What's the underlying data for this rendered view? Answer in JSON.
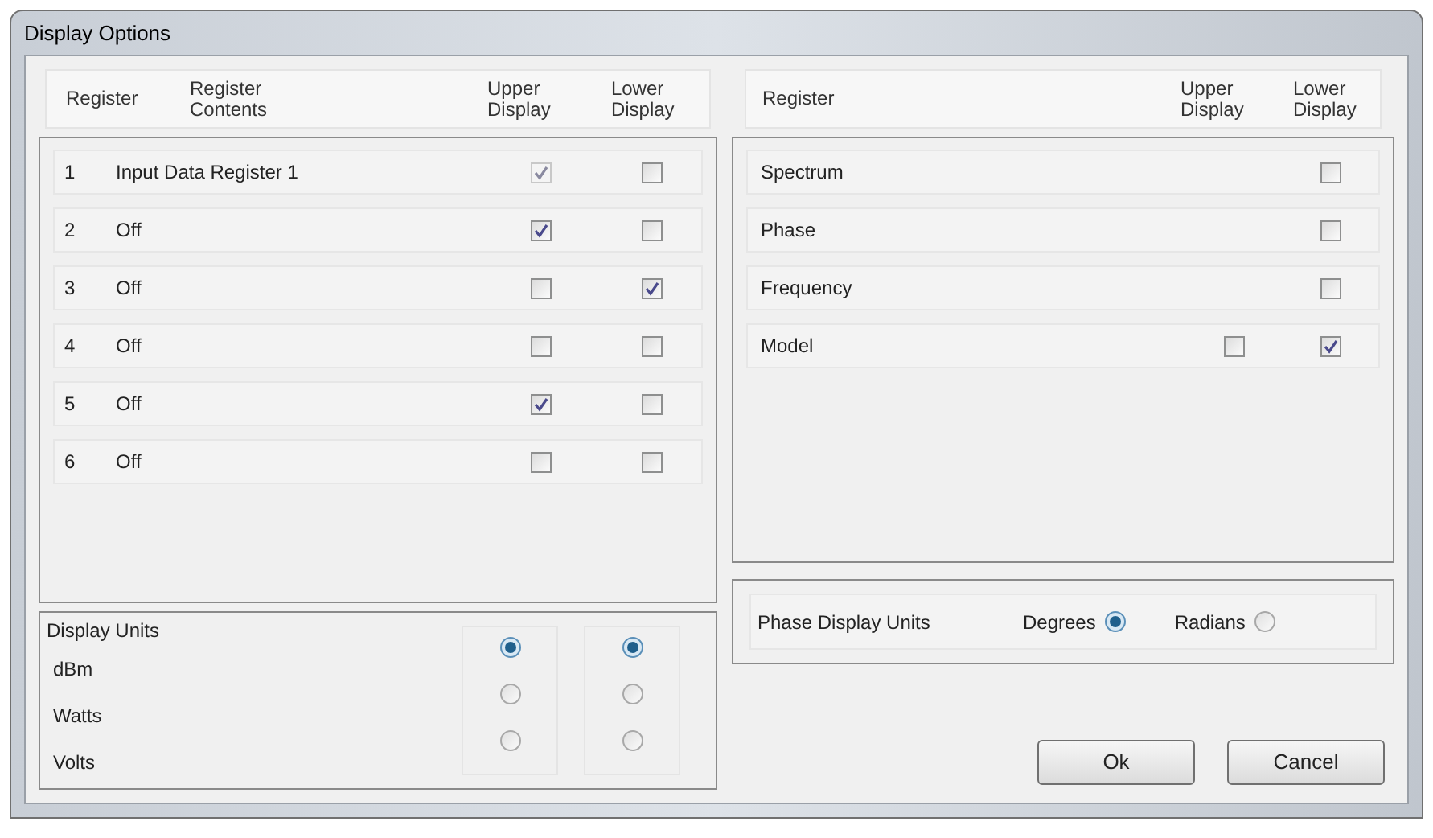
{
  "window": {
    "title": "Display Options"
  },
  "register_table": {
    "columns": [
      "Register",
      "Register Contents",
      "Upper Display",
      "Lower Display"
    ],
    "rows": [
      {
        "register": "1",
        "contents": "Input Data Register 1",
        "upper": {
          "checked": true,
          "disabled": true
        },
        "lower": {
          "checked": false,
          "disabled": false
        }
      },
      {
        "register": "2",
        "contents": "Off",
        "upper": {
          "checked": true,
          "disabled": false
        },
        "lower": {
          "checked": false,
          "disabled": false
        }
      },
      {
        "register": "3",
        "contents": "Off",
        "upper": {
          "checked": false,
          "disabled": false
        },
        "lower": {
          "checked": true,
          "disabled": false
        }
      },
      {
        "register": "4",
        "contents": "Off",
        "upper": {
          "checked": false,
          "disabled": false
        },
        "lower": {
          "checked": false,
          "disabled": false
        }
      },
      {
        "register": "5",
        "contents": "Off",
        "upper": {
          "checked": true,
          "disabled": false
        },
        "lower": {
          "checked": false,
          "disabled": false
        }
      },
      {
        "register": "6",
        "contents": "Off",
        "upper": {
          "checked": false,
          "disabled": false
        },
        "lower": {
          "checked": false,
          "disabled": false
        }
      }
    ]
  },
  "display_units": {
    "title": "Display Units",
    "options": [
      {
        "label": "dBm",
        "upper_selected": true,
        "lower_selected": true
      },
      {
        "label": "Watts",
        "upper_selected": false,
        "lower_selected": false
      },
      {
        "label": "Volts",
        "upper_selected": false,
        "lower_selected": false
      }
    ]
  },
  "signal_table": {
    "columns": [
      "Register",
      "Upper Display",
      "Lower Display"
    ],
    "rows": [
      {
        "register": "Spectrum",
        "lower": {
          "checked": false,
          "disabled": false
        }
      },
      {
        "register": "Phase",
        "lower": {
          "checked": false,
          "disabled": false
        }
      },
      {
        "register": "Frequency",
        "lower": {
          "checked": false,
          "disabled": false
        }
      },
      {
        "register": "Model",
        "upper": {
          "checked": false,
          "disabled": false
        },
        "lower": {
          "checked": true,
          "disabled": false
        }
      }
    ]
  },
  "phase_units": {
    "label": "Phase Display Units",
    "options": [
      {
        "label": "Degrees",
        "selected": true
      },
      {
        "label": "Radians",
        "selected": false
      }
    ]
  },
  "buttons": [
    "Ok",
    "Cancel"
  ]
}
